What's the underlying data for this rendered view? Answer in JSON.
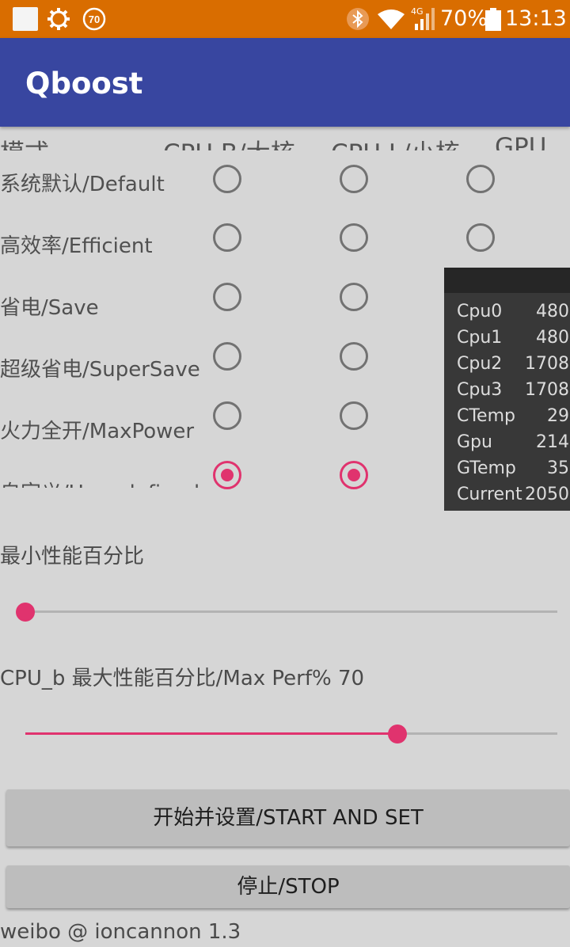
{
  "status_bar": {
    "badge_number": "70",
    "network_type": "4G",
    "battery_percent": "70%",
    "time": "13:13",
    "background_color": "#d96d00"
  },
  "app_bar": {
    "title": "Qboost",
    "background_color": "#3846a0"
  },
  "mode_table": {
    "headers": {
      "mode": "模式",
      "cpu_big": "CPU B/大核",
      "cpu_little": "CPU L/小核",
      "gpu": "GPU"
    },
    "rows": [
      {
        "label": "系统默认/Default",
        "cpu_big_checked": false,
        "cpu_little_checked": false,
        "gpu_checked": false
      },
      {
        "label": "高效率/Efficient",
        "cpu_big_checked": false,
        "cpu_little_checked": false,
        "gpu_checked": false
      },
      {
        "label": "省电/Save",
        "cpu_big_checked": false,
        "cpu_little_checked": false
      },
      {
        "label": "超级省电/SuperSave",
        "cpu_big_checked": false,
        "cpu_little_checked": false
      },
      {
        "label": "火力全开/MaxPower",
        "cpu_big_checked": false,
        "cpu_little_checked": false
      },
      {
        "label": "自定义/User defined",
        "cpu_big_checked": true,
        "cpu_little_checked": true
      }
    ],
    "accent_color": "#e0336e"
  },
  "monitor": {
    "items": [
      {
        "name": "Cpu0",
        "value": "480"
      },
      {
        "name": "Cpu1",
        "value": "480"
      },
      {
        "name": "Cpu2",
        "value": "1708"
      },
      {
        "name": "Cpu3",
        "value": "1708"
      },
      {
        "name": "CTemp",
        "value": "29"
      },
      {
        "name": "Gpu",
        "value": "214"
      },
      {
        "name": "GTemp",
        "value": "35"
      },
      {
        "name": "Current",
        "value": "2050"
      }
    ]
  },
  "min_perf": {
    "label": "最小性能百分比",
    "value_fraction": 0.0
  },
  "max_perf": {
    "label": "CPU_b 最大性能百分比/Max Perf% 70",
    "value_fraction": 0.7
  },
  "buttons": {
    "start_set": "开始并设置/START AND SET",
    "stop": "停止/STOP"
  },
  "footer": "weibo @ ioncannon 1.3"
}
